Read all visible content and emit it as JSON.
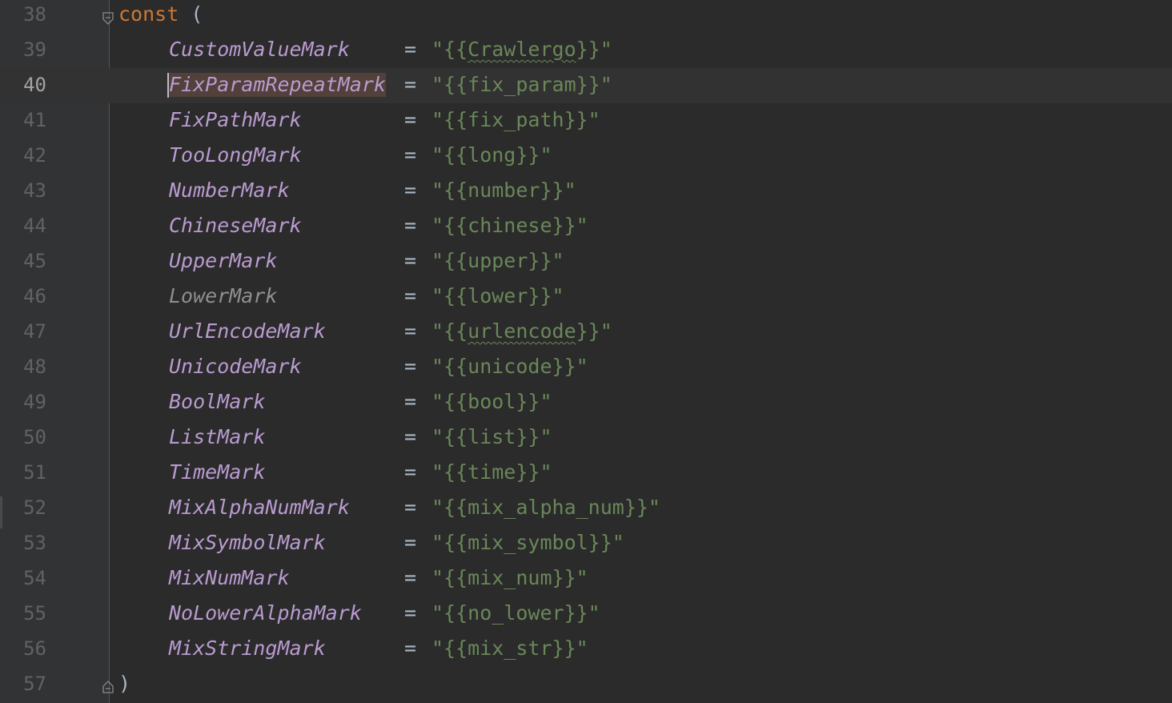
{
  "editor": {
    "current_line": 40,
    "keyword": "const",
    "open_paren": "(",
    "close_paren": ")",
    "equals": "=",
    "first_line_number": 38,
    "last_line_number": 57
  },
  "entries": [
    {
      "line": 39,
      "name": "CustomValueMark",
      "value": "\"{{Crawlergo}}\"",
      "value_pre": "\"{{",
      "value_mid": "Crawlergo",
      "value_post": "}}\"",
      "squiggle": true,
      "unused": false
    },
    {
      "line": 40,
      "name": "FixParamRepeatMark",
      "value": "\"{{fix_param}}\"",
      "squiggle": false,
      "unused": false,
      "highlighted": true
    },
    {
      "line": 41,
      "name": "FixPathMark",
      "value": "\"{{fix_path}}\"",
      "squiggle": false,
      "unused": false
    },
    {
      "line": 42,
      "name": "TooLongMark",
      "value": "\"{{long}}\"",
      "squiggle": false,
      "unused": false
    },
    {
      "line": 43,
      "name": "NumberMark",
      "value": "\"{{number}}\"",
      "squiggle": false,
      "unused": false
    },
    {
      "line": 44,
      "name": "ChineseMark",
      "value": "\"{{chinese}}\"",
      "squiggle": false,
      "unused": false
    },
    {
      "line": 45,
      "name": "UpperMark",
      "value": "\"{{upper}}\"",
      "squiggle": false,
      "unused": false
    },
    {
      "line": 46,
      "name": "LowerMark",
      "value": "\"{{lower}}\"",
      "squiggle": false,
      "unused": true
    },
    {
      "line": 47,
      "name": "UrlEncodeMark",
      "value": "\"{{urlencode}}\"",
      "value_pre": "\"{{",
      "value_mid": "urlencode",
      "value_post": "}}\"",
      "squiggle": true,
      "unused": false
    },
    {
      "line": 48,
      "name": "UnicodeMark",
      "value": "\"{{unicode}}\"",
      "squiggle": false,
      "unused": false
    },
    {
      "line": 49,
      "name": "BoolMark",
      "value": "\"{{bool}}\"",
      "squiggle": false,
      "unused": false
    },
    {
      "line": 50,
      "name": "ListMark",
      "value": "\"{{list}}\"",
      "squiggle": false,
      "unused": false
    },
    {
      "line": 51,
      "name": "TimeMark",
      "value": "\"{{time}}\"",
      "squiggle": false,
      "unused": false
    },
    {
      "line": 52,
      "name": "MixAlphaNumMark",
      "value": "\"{{mix_alpha_num}}\"",
      "squiggle": false,
      "unused": false
    },
    {
      "line": 53,
      "name": "MixSymbolMark",
      "value": "\"{{mix_symbol}}\"",
      "squiggle": false,
      "unused": false
    },
    {
      "line": 54,
      "name": "MixNumMark",
      "value": "\"{{mix_num}}\"",
      "squiggle": false,
      "unused": false
    },
    {
      "line": 55,
      "name": "NoLowerAlphaMark",
      "value": "\"{{no_lower}}\"",
      "squiggle": false,
      "unused": false
    },
    {
      "line": 56,
      "name": "MixStringMark",
      "value": "\"{{mix_str}}\"",
      "squiggle": false,
      "unused": false
    }
  ],
  "icons": {
    "fold_open": "fold-collapse-icon",
    "fold_close": "fold-end-icon"
  },
  "colors": {
    "background": "#2b2b2b",
    "gutter": "#313335",
    "current_line": "#323232",
    "keyword": "#cc7832",
    "constant": "#b99bd0",
    "unused_constant": "#8f8f8f",
    "string": "#6a8759",
    "operator": "#a9b7c6",
    "line_number": "#606366"
  }
}
